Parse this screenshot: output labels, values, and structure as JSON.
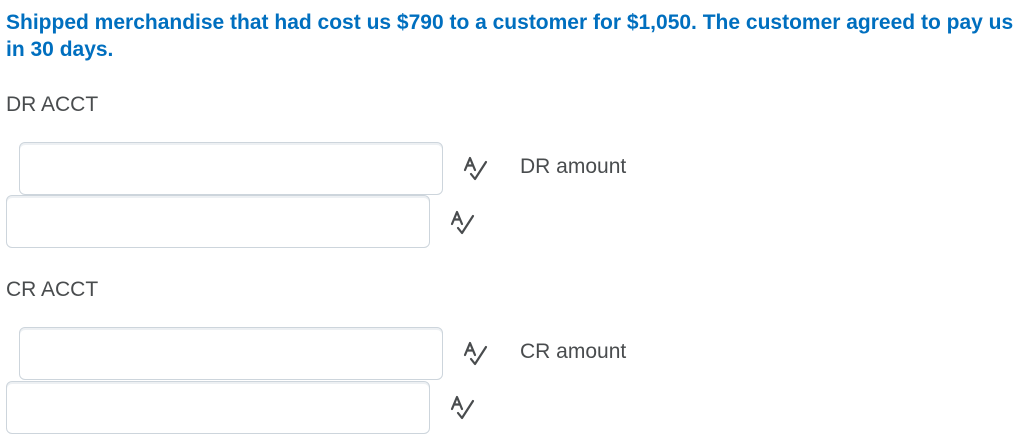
{
  "question": {
    "text": "Shipped merchandise that had cost us $790 to a customer for $1,050. The customer agreed to pay us in 30 days."
  },
  "debit": {
    "section_label": "DR ACCT",
    "inputs": [
      {
        "value": "",
        "placeholder": ""
      },
      {
        "value": "",
        "placeholder": ""
      }
    ],
    "amount_label": "DR amount"
  },
  "credit": {
    "section_label": "CR ACCT",
    "inputs": [
      {
        "value": "",
        "placeholder": ""
      },
      {
        "value": "",
        "placeholder": ""
      }
    ],
    "amount_label": "CR amount"
  },
  "icons": {
    "spellcheck": "spellcheck-icon"
  },
  "colors": {
    "question_text": "#006fbf",
    "body_text": "#494c4e",
    "input_border": "#cdd5dc"
  }
}
